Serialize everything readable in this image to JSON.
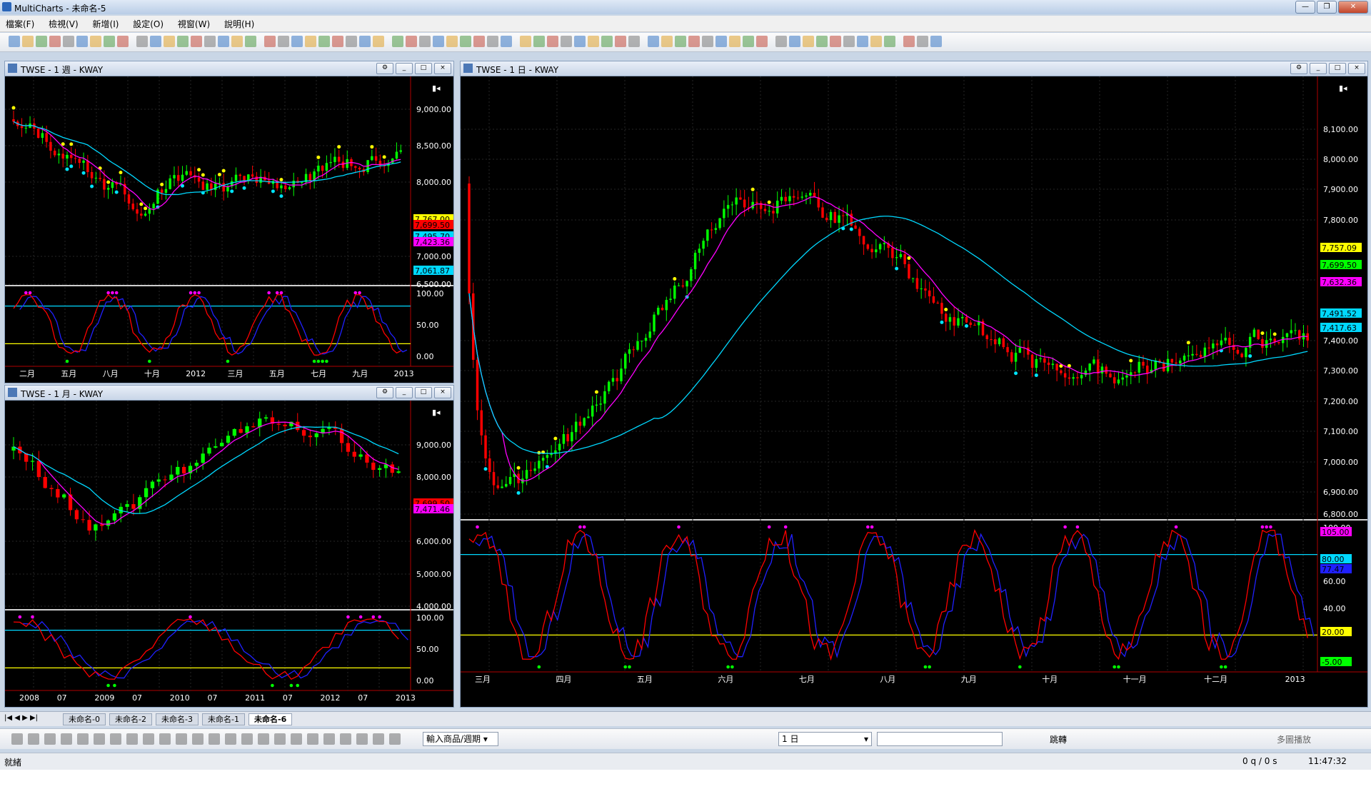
{
  "app": {
    "window_title": "MultiCharts - 未命名-5"
  },
  "menu": [
    "檔案(F)",
    "檢視(V)",
    "新增(I)",
    "設定(O)",
    "視窗(W)",
    "說明(H)"
  ],
  "colors": {
    "background": "#000000",
    "bull": "#00ff00",
    "bear": "#ff0000",
    "ma_fast": "#ff00ff",
    "ma_slow": "#00d8ff",
    "stoch_k": "#ff0000",
    "stoch_d": "#2020ff",
    "upper_band": "#00d8ff",
    "lower_band": "#ffff00",
    "marker_high": "#ffff00",
    "marker_low": "#00e5ff"
  },
  "charts": {
    "weekly": {
      "title": "TWSE - 1 週 - KWAY",
      "price_ticks": [
        "9,000.00",
        "8,500.00",
        "8,000.00",
        "7,000.00",
        "6,500.00"
      ],
      "price_labels": [
        {
          "text": "7,767.00",
          "color": "#ffff00"
        },
        {
          "text": "7,699.50",
          "color": "#ff0000"
        },
        {
          "text": "7,495.70",
          "color": "#00d8ff"
        },
        {
          "text": "7,423.36",
          "color": "#ff00ff"
        },
        {
          "text": "7,061.87",
          "color": "#00d8ff"
        }
      ],
      "osc_ticks": [
        "100.00",
        "50.00",
        "0.00"
      ],
      "x_labels": [
        "二月",
        "五月",
        "八月",
        "十月",
        "2012",
        "三月",
        "五月",
        "七月",
        "九月",
        "2013"
      ]
    },
    "monthly": {
      "title": "TWSE - 1 月 - KWAY",
      "price_ticks": [
        "9,000.00",
        "8,000.00",
        "7,000.00",
        "6,000.00",
        "5,000.00",
        "4,000.00"
      ],
      "price_labels": [
        {
          "text": "7,699.50",
          "color": "#ff0000"
        },
        {
          "text": "7,471.46",
          "color": "#ff00ff"
        }
      ],
      "osc_ticks": [
        "100.00",
        "50.00",
        "0.00"
      ],
      "x_labels": [
        "2008",
        "07",
        "2009",
        "07",
        "2010",
        "07",
        "2011",
        "07",
        "2012",
        "07",
        "2013"
      ]
    },
    "daily": {
      "title": "TWSE - 1 日 - KWAY",
      "price_ticks": [
        "8,100.00",
        "8,000.00",
        "7,900.00",
        "7,800.00",
        "7,600.00",
        "7,400.00",
        "7,300.00",
        "7,200.00",
        "7,100.00",
        "7,000.00",
        "6,900.00",
        "6,800.00"
      ],
      "price_labels": [
        {
          "text": "7,757.09",
          "color": "#ffff00"
        },
        {
          "text": "7,699.50",
          "color": "#00ff00"
        },
        {
          "text": "7,632.36",
          "color": "#ff00ff"
        },
        {
          "text": "7,491.52",
          "color": "#00d8ff"
        },
        {
          "text": "7,417.63",
          "color": "#00d8ff"
        }
      ],
      "osc_ticks": [
        "100.00",
        "60.00",
        "40.00",
        "0.00"
      ],
      "osc_labels": [
        {
          "text": "105.00",
          "color": "#ff00ff"
        },
        {
          "text": "80.00",
          "color": "#00d8ff"
        },
        {
          "text": "77.47",
          "color": "#2020ff"
        },
        {
          "text": "20.00",
          "color": "#ffff00"
        },
        {
          "text": "-5.00",
          "color": "#00ff00"
        }
      ],
      "x_labels": [
        "三月",
        "四月",
        "五月",
        "六月",
        "七月",
        "八月",
        "九月",
        "十月",
        "十一月",
        "十二月",
        "2013"
      ]
    }
  },
  "tabs": [
    "未命名-0",
    "未命名-2",
    "未命名-3",
    "未命名-1",
    "未命名-6"
  ],
  "active_tab": "未命名-6",
  "drawing_toolbar": {
    "symbol_combo": "輸入商品/週期",
    "interval_combo": "1 日",
    "jump_label": "跳轉",
    "multi_play_label": "多圖播放"
  },
  "status": {
    "text": "就緒",
    "queue": "0 q / 0 s",
    "time": "11:47:32"
  }
}
